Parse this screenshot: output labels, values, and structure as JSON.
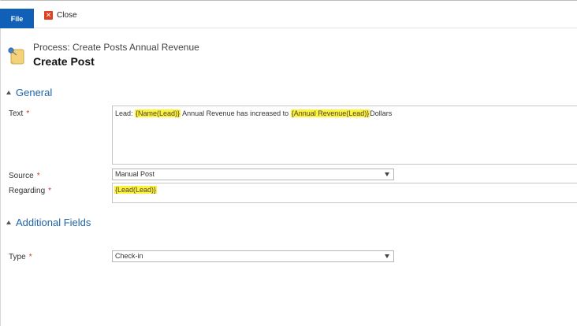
{
  "ribbon": {
    "file_label": "File",
    "close_label": "Close"
  },
  "header": {
    "process_line": "Process: Create Posts Annual Revenue",
    "title": "Create Post"
  },
  "sections": {
    "general": "General",
    "additional": "Additional Fields"
  },
  "fields": {
    "text": {
      "label": "Text",
      "required_mark": "*",
      "value_parts": {
        "p1": "Lead: ",
        "h1": "{Name(Lead)}",
        "p2": " Annual Revenue has increased to ",
        "h2": "{Annual Revenue(Lead)}",
        "p3": "Dollars"
      }
    },
    "source": {
      "label": "Source",
      "required_mark": "*",
      "value": "Manual Post"
    },
    "regarding": {
      "label": "Regarding",
      "required_mark": "*",
      "value": "{Lead(Lead)}"
    },
    "type": {
      "label": "Type",
      "required_mark": "*",
      "value": "Check-in"
    }
  },
  "colors": {
    "file_button": "#1160b7",
    "section_header": "#1f64a8",
    "highlight": "#fff33a",
    "required": "#d4312b",
    "close_icon": "#e0401f"
  },
  "icons": {
    "close": "close-icon",
    "post": "post-note-icon",
    "collapse": "collapse-triangle-icon",
    "dropdown": "chevron-down-icon"
  }
}
